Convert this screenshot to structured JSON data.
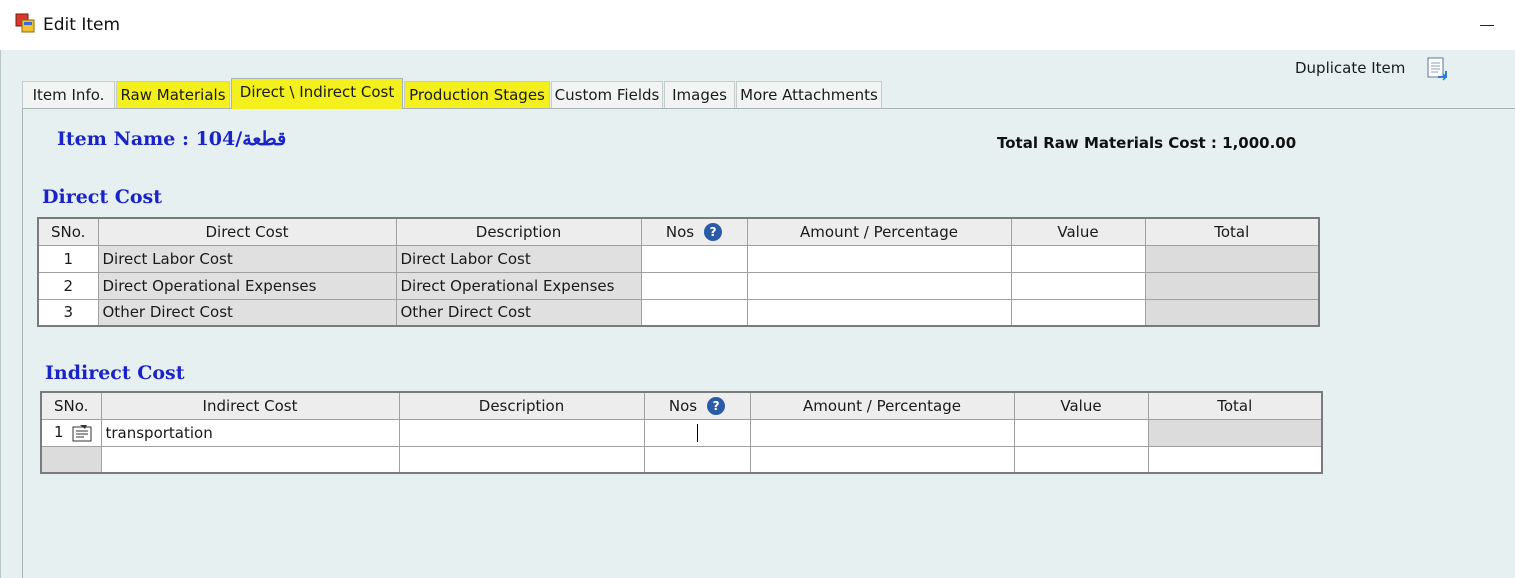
{
  "window": {
    "title": "Edit Item",
    "app_icon": "app-window-icon",
    "minimize_icon": "minimize-icon"
  },
  "toolbar": {
    "duplicate_label": "Duplicate Item",
    "duplicate_icon": "document-copy-icon"
  },
  "tabs": [
    {
      "label": "Item Info.",
      "highlighted": false
    },
    {
      "label": "Raw Materials",
      "highlighted": true
    },
    {
      "label": "Direct \\ Indirect Cost",
      "highlighted": true,
      "active": true
    },
    {
      "label": "Production Stages",
      "highlighted": true
    },
    {
      "label": "Custom Fields",
      "highlighted": false
    },
    {
      "label": "Images",
      "highlighted": false
    },
    {
      "label": "More Attachments",
      "highlighted": false
    }
  ],
  "header": {
    "item_name": "Item Name : 104/قطعة",
    "total_raw_materials": "Total Raw Materials Cost : 1,000.00"
  },
  "direct_cost": {
    "title": "Direct Cost",
    "columns": [
      "SNo.",
      "Direct Cost",
      "Description",
      "Nos",
      "Amount / Percentage",
      "Value",
      "Total"
    ],
    "rows": [
      {
        "sno": "1",
        "cost": "Direct Labor Cost",
        "description": "Direct Labor Cost",
        "nos": "",
        "amount": "",
        "value": "",
        "total": ""
      },
      {
        "sno": "2",
        "cost": "Direct Operational Expenses",
        "description": "Direct Operational Expenses",
        "nos": "",
        "amount": "",
        "value": "",
        "total": ""
      },
      {
        "sno": "3",
        "cost": "Other Direct Cost",
        "description": "Other Direct Cost",
        "nos": "",
        "amount": "",
        "value": "",
        "total": ""
      }
    ]
  },
  "indirect_cost": {
    "title": "Indirect Cost",
    "columns": [
      "SNo.",
      "Indirect Cost",
      "Description",
      "Nos",
      "Amount / Percentage",
      "Value",
      "Total"
    ],
    "rows": [
      {
        "sno": "1",
        "cost": "transportation",
        "description": "",
        "nos": "",
        "amount": "",
        "value": "",
        "total": ""
      },
      {
        "sno": "",
        "cost": "",
        "description": "",
        "nos": "",
        "amount": "",
        "value": "",
        "total": ""
      }
    ]
  },
  "help_glyph": "?",
  "colors": {
    "highlight": "#f4f01e",
    "section_title": "#1a23c8",
    "panel_bg": "#e6f0f0"
  }
}
